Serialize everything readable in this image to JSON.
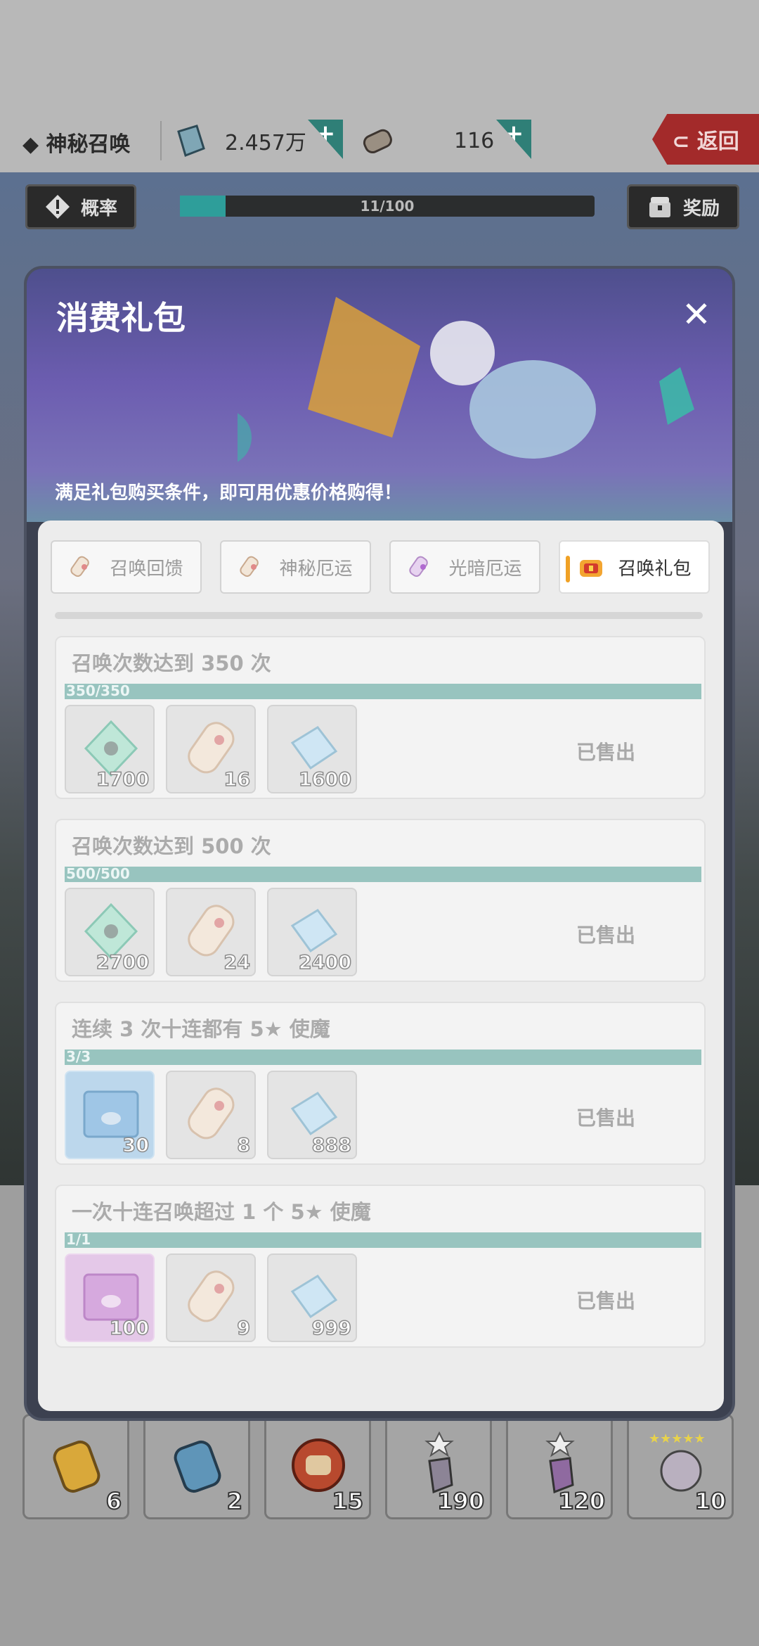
{
  "header": {
    "title": "◆ 神秘召唤",
    "currency1_value": "2.457万",
    "currency2_value": "116",
    "plus_label": "+",
    "back_label": "⊂ 返回",
    "rate_label": "概率",
    "reward_label": "奖励",
    "summon_progress_text": "11/100",
    "summon_progress_fraction": 0.11
  },
  "bottom_items": [
    {
      "name": "golden-scroll",
      "count": "6"
    },
    {
      "name": "blue-scroll",
      "count": "2"
    },
    {
      "name": "red-scroll",
      "count": "15"
    },
    {
      "name": "star-crystal",
      "count": "190"
    },
    {
      "name": "purple-crystal",
      "count": "120"
    },
    {
      "name": "five-star-ticket",
      "count": "10"
    }
  ],
  "modal": {
    "title": "消费礼包",
    "close_label": "✕",
    "subtitle": "满足礼包购买条件，即可用优惠价格购得！",
    "tabs": [
      {
        "label": "召唤回馈",
        "active": false
      },
      {
        "label": "神秘厄运",
        "active": false
      },
      {
        "label": "光暗厄运",
        "active": false
      },
      {
        "label": "召唤礼包",
        "active": true
      }
    ],
    "packs": [
      {
        "title": "召唤次数达到 350 次",
        "progress_text": "350/350",
        "progress_fraction": 1.0,
        "items": [
          {
            "icon": "green-diamond-icon",
            "count": "1700"
          },
          {
            "icon": "scroll-icon",
            "count": "16"
          },
          {
            "icon": "blue-gem-icon",
            "count": "1600"
          }
        ],
        "status": "已售出"
      },
      {
        "title": "召唤次数达到 500 次",
        "progress_text": "500/500",
        "progress_fraction": 1.0,
        "items": [
          {
            "icon": "green-diamond-icon",
            "count": "2700"
          },
          {
            "icon": "scroll-icon",
            "count": "24"
          },
          {
            "icon": "blue-gem-icon",
            "count": "2400"
          }
        ],
        "status": "已售出"
      },
      {
        "title": "连续 3 次十连都有 5★ 使魔",
        "progress_text": "3/3",
        "progress_fraction": 1.0,
        "items": [
          {
            "icon": "blue-card-icon",
            "count": "30"
          },
          {
            "icon": "scroll-icon",
            "count": "8"
          },
          {
            "icon": "blue-gem-icon",
            "count": "888"
          }
        ],
        "status": "已售出"
      },
      {
        "title": "一次十连召唤超过 1 个 5★ 使魔",
        "progress_text": "1/1",
        "progress_fraction": 1.0,
        "items": [
          {
            "icon": "purple-card-icon",
            "count": "100"
          },
          {
            "icon": "scroll-icon",
            "count": "9"
          },
          {
            "icon": "blue-gem-icon",
            "count": "999"
          }
        ],
        "status": "已售出"
      }
    ]
  }
}
